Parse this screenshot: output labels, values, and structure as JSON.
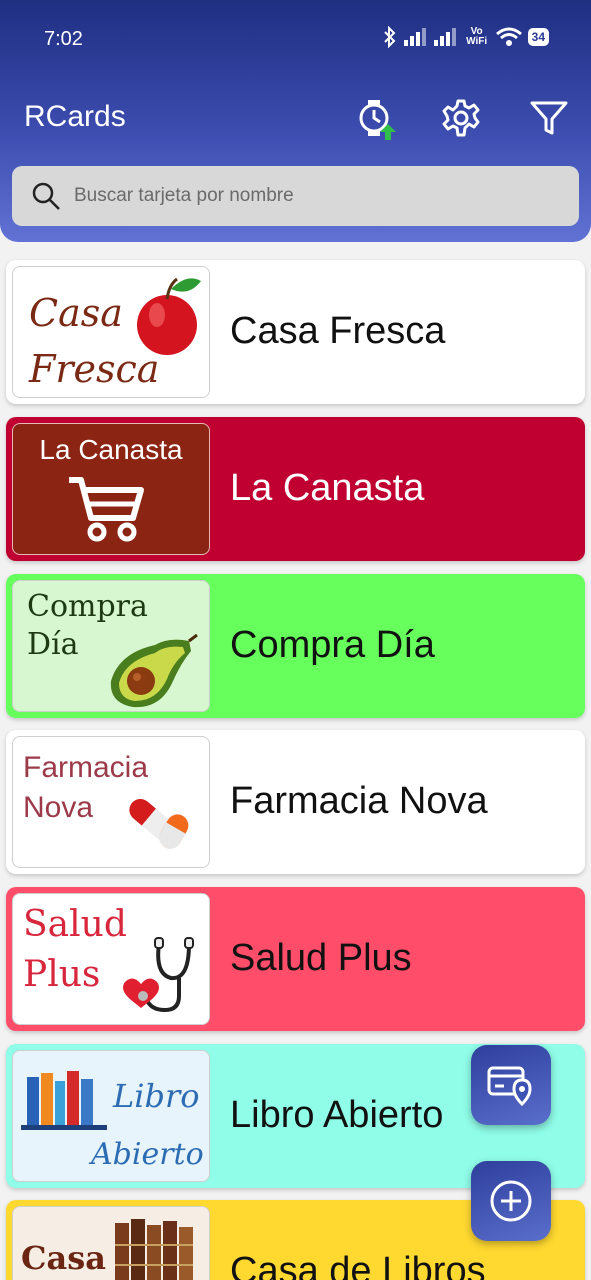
{
  "status_bar": {
    "time": "7:02",
    "network_label": "Vo WiFi",
    "battery": "34"
  },
  "header": {
    "title": "RCards",
    "actions": [
      "watch-sync-icon",
      "gear-icon",
      "filter-icon"
    ]
  },
  "search": {
    "placeholder": "Buscar tarjeta por nombre"
  },
  "cards": [
    {
      "name": "Casa Fresca",
      "logo_text": [
        "Casa",
        "Fresca"
      ],
      "bg": "#ffffff"
    },
    {
      "name": "La Canasta",
      "logo_text": [
        "La Canasta"
      ],
      "bg": "#c00030"
    },
    {
      "name": "Compra Día",
      "logo_text": [
        "Compra",
        "Día"
      ],
      "bg": "#66ff5c"
    },
    {
      "name": "Farmacia Nova",
      "logo_text": [
        "Farmacia",
        "Nova"
      ],
      "bg": "#ffffff"
    },
    {
      "name": "Salud Plus",
      "logo_text": [
        "Salud",
        "Plus"
      ],
      "bg": "#ff4d6a"
    },
    {
      "name": "Libro Abierto",
      "logo_text": [
        "Libro",
        "Abierto"
      ],
      "bg": "#8ffde8"
    },
    {
      "name": "Casa de Libros",
      "logo_text": [
        "Casa"
      ],
      "bg": "#ffd930"
    }
  ],
  "fabs": [
    "card-location-icon",
    "add-icon"
  ]
}
